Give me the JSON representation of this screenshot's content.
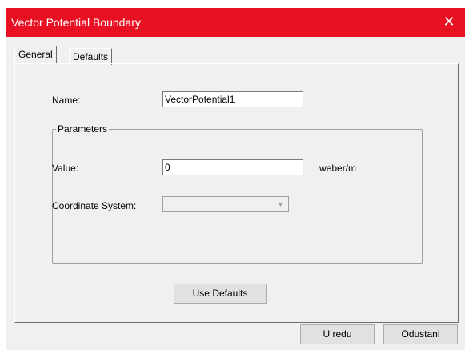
{
  "window": {
    "title": "Vector Potential Boundary",
    "close_icon": "close-icon"
  },
  "tabs": [
    {
      "label": "General",
      "active": true
    },
    {
      "label": "Defaults",
      "active": false
    }
  ],
  "general": {
    "name_label": "Name:",
    "name_value": "VectorPotential1",
    "parameters_group": "Parameters",
    "value_label": "Value:",
    "value_value": "0",
    "value_unit": "weber/m",
    "coord_label": "Coordinate System:",
    "coord_value": "",
    "use_defaults_label": "Use Defaults"
  },
  "footer": {
    "ok_label": "U redu",
    "cancel_label": "Odustani"
  },
  "colors": {
    "titlebar": "#e81123",
    "dialog_bg": "#f0f0f0"
  }
}
